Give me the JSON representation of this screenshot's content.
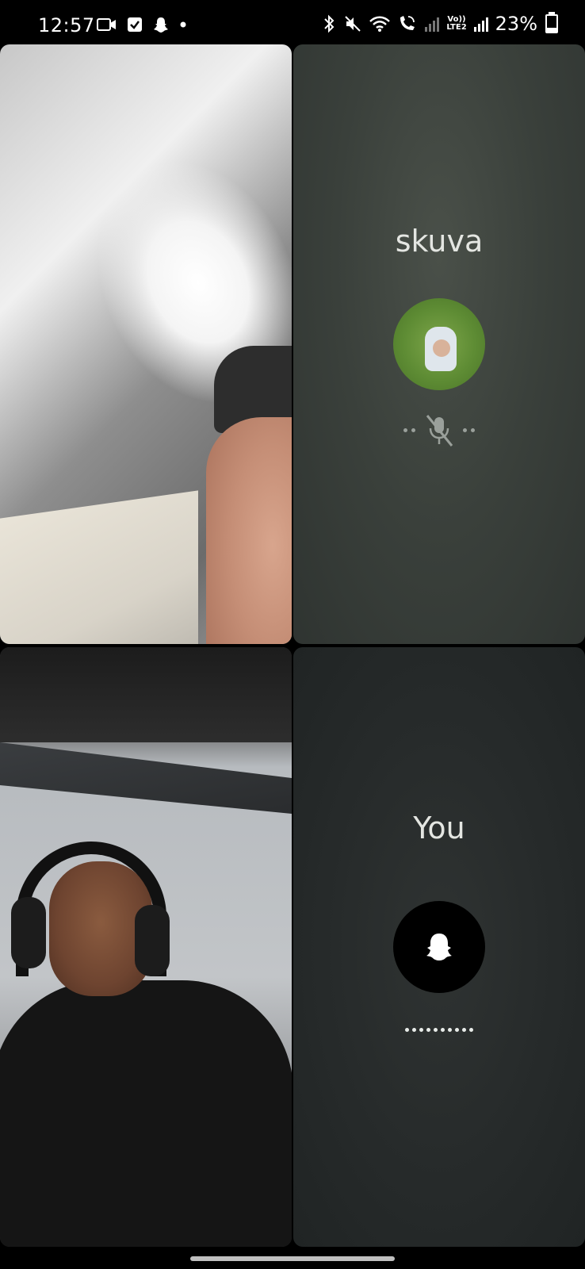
{
  "status_bar": {
    "time": "12:57",
    "battery_percent": "23%",
    "battery_level": 0.23,
    "lte_label_top": "Vo))",
    "lte_label_bottom": "LTE2",
    "icons": [
      "video-camera-icon",
      "checkbox-icon",
      "snapchat-icon",
      "notification-dot-icon",
      "bluetooth-icon",
      "mute-icon",
      "wifi-icon",
      "wifi-calling-icon",
      "signal-icon",
      "volte-icon",
      "signal-icon",
      "battery-icon"
    ]
  },
  "participants": {
    "remote": {
      "name": "skuva",
      "mic_state": "muted",
      "avatar": "grass-photo-avatar"
    },
    "self": {
      "name": "You",
      "avatar": "ghost-icon",
      "mic_state": "speaking"
    }
  },
  "colors": {
    "remote_card_bg": "#3a403b",
    "self_card_bg": "#272b2b",
    "name_text": "#e4e6e2"
  }
}
